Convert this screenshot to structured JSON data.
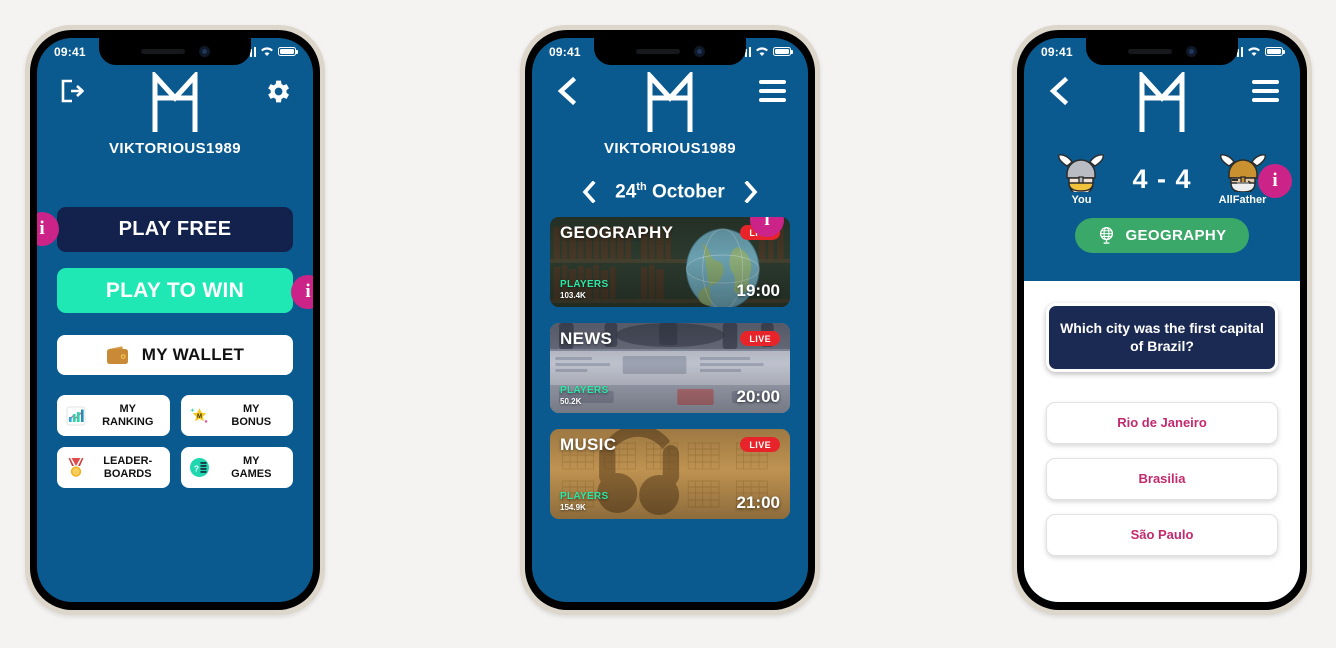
{
  "theme": {
    "brand_blue": "#0a5a8f",
    "accent_pink": "#cc2388",
    "accent_teal": "#1fe8b5",
    "dark_navy": "#12224c",
    "green": "#3aa868",
    "live_red": "#e8242b",
    "answer_pink": "#c22a6e",
    "page_bg": "#f4f3f1"
  },
  "status_bar": {
    "time": "09:41",
    "signal_icon": "signal-bars-icon",
    "wifi_icon": "wifi-icon",
    "battery_icon": "battery-icon"
  },
  "screen1": {
    "header": {
      "logout_icon": "logout-icon",
      "logo_icon": "rune-logo-icon",
      "settings_icon": "gear-icon",
      "username": "VIKTORIOUS1989"
    },
    "buttons": {
      "play_free": "PLAY FREE",
      "play_to_win": "PLAY TO WIN",
      "my_wallet": "MY WALLET",
      "wallet_icon": "wallet-icon",
      "info_free_label": "i",
      "info_win_label": "i"
    },
    "tiles": [
      {
        "label": "MY\nRANKING",
        "line1": "MY",
        "line2": "RANKING",
        "icon": "bar-chart-icon"
      },
      {
        "label": "MY BONUS",
        "line1": "MY",
        "line2": "BONUS",
        "icon": "star-icon"
      },
      {
        "label": "LEADERBOARDS",
        "line1": "LEADER-",
        "line2": "BOARDS",
        "icon": "medal-icon"
      },
      {
        "label": "MY GAMES",
        "line1": "MY",
        "line2": "GAMES",
        "icon": "quiz-icon"
      }
    ]
  },
  "screen2": {
    "header": {
      "back_icon": "chevron-left-icon",
      "logo_icon": "rune-logo-icon",
      "menu_icon": "hamburger-menu-icon",
      "username": "VIKTORIOUS1989"
    },
    "date_nav": {
      "prev_icon": "chevron-left-icon",
      "next_icon": "chevron-right-icon",
      "day": "24",
      "ordinal": "th",
      "month": "October"
    },
    "info_badge_label": "i",
    "cards": [
      {
        "title": "GEOGRAPHY",
        "live": "LIVE",
        "players_label": "PLAYERS",
        "players_count": "103.4K",
        "time": "19:00",
        "theme": "library-globe"
      },
      {
        "title": "NEWS",
        "live": "LIVE",
        "players_label": "PLAYERS",
        "players_count": "50.2K",
        "time": "20:00",
        "theme": "printing-press"
      },
      {
        "title": "MUSIC",
        "live": "LIVE",
        "players_label": "PLAYERS",
        "players_count": "154.9K",
        "time": "21:00",
        "theme": "headphones-sheet"
      }
    ]
  },
  "screen3": {
    "header": {
      "back_icon": "chevron-left-icon",
      "logo_icon": "rune-logo-icon",
      "menu_icon": "hamburger-menu-icon"
    },
    "match": {
      "player_you": "You",
      "player_opponent": "AllFather",
      "score": "4 - 4",
      "you_avatar_icon": "viking-helmet-avatar-icon",
      "opponent_avatar_icon": "allfather-helmet-avatar-icon",
      "info_badge_label": "i"
    },
    "category": {
      "name": "GEOGRAPHY",
      "icon": "globe-icon"
    },
    "question": "Which city was the first capital of Brazil?",
    "answers": [
      "Rio de Janeiro",
      "Brasilia",
      "São Paulo"
    ]
  }
}
